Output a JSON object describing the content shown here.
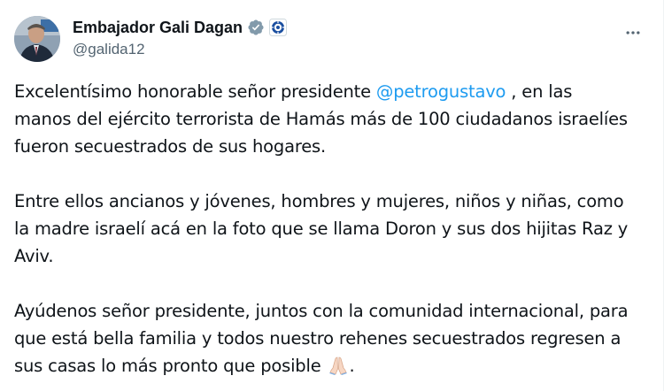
{
  "author": {
    "display_name": "Embajador Gali Dagan",
    "handle": "@galida12",
    "verified_icon": "verified-badge-icon",
    "affiliation_icon": "affiliation-badge-icon",
    "avatar": "avatar-photo"
  },
  "menu": {
    "more_icon": "more-horizontal-icon"
  },
  "tweet": {
    "p1_before": "Excelentísimo honorable señor presidente ",
    "p1_mention": "@petrogustavo",
    "p1_after": " , en las manos del ejército terrorista de Hamás más de 100 ciudadanos israelíes fueron secuestrados de sus hogares.",
    "p2": "Entre ellos ancianos y jóvenes, hombres y mujeres, niños y niñas, como la madre israelí acá en la foto que se llama Doron y sus dos hijitas Raz y Aviv.",
    "p3_text": "Ayúdenos señor presidente, juntos con la comunidad internacional, para que está bella familia y todos nuestro rehenes secuestrados regresen a sus casas lo más pronto que posible ",
    "p3_end": ".",
    "p3_emoji": "folded-hands-emoji"
  },
  "colors": {
    "text": "#0f1419",
    "secondary": "#536471",
    "link": "#1d9bf0",
    "verified": "#829aab"
  }
}
